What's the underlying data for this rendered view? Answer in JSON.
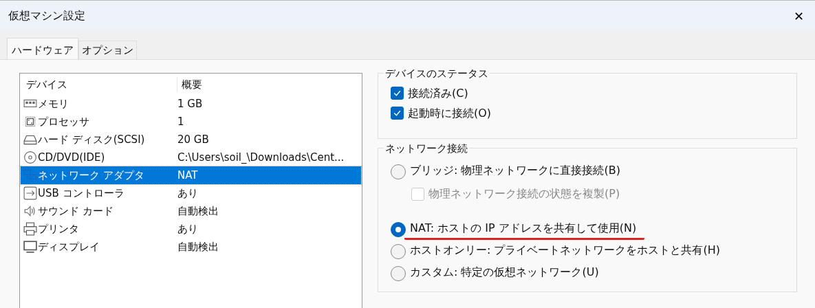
{
  "window": {
    "title": "仮想マシン設定",
    "close": "✕"
  },
  "tabs": [
    {
      "label": "ハードウェア",
      "selected": true
    },
    {
      "label": "オプション",
      "selected": false
    }
  ],
  "devices": {
    "columns": [
      "デバイス",
      "概要"
    ],
    "rows": [
      {
        "kind": "memory",
        "name": "メモリ",
        "summary": "1 GB",
        "selected": false
      },
      {
        "kind": "processor",
        "name": "プロセッサ",
        "summary": "1",
        "selected": false
      },
      {
        "kind": "disk",
        "name": "ハード ディスク(SCSI)",
        "summary": "20 GB",
        "selected": false
      },
      {
        "kind": "cd",
        "name": "CD/DVD(IDE)",
        "summary": "C:\\Users\\soil_\\Downloads\\Cent...",
        "selected": false
      },
      {
        "kind": "network",
        "name": "ネットワーク アダプタ",
        "summary": "NAT",
        "selected": true
      },
      {
        "kind": "usb",
        "name": "USB コントローラ",
        "summary": "あり",
        "selected": false
      },
      {
        "kind": "sound",
        "name": "サウンド カード",
        "summary": "自動検出",
        "selected": false
      },
      {
        "kind": "printer",
        "name": "プリンタ",
        "summary": "あり",
        "selected": false
      },
      {
        "kind": "display",
        "name": "ディスプレイ",
        "summary": "自動検出",
        "selected": false
      }
    ]
  },
  "device_status": {
    "title": "デバイスのステータス",
    "options": [
      {
        "label": "接続済み(C)",
        "checked": true
      },
      {
        "label": "起動時に接続(O)",
        "checked": true
      }
    ]
  },
  "network_connection": {
    "title": "ネットワーク接続",
    "options": [
      {
        "kind": "radio",
        "label": "ブリッジ: 物理ネットワークに直接接続(B)",
        "selected": false,
        "underlined": false
      },
      {
        "kind": "checkbox",
        "label": "物理ネットワーク接続の状態を複製(P)",
        "checked": false,
        "disabled": true
      },
      {
        "kind": "radio",
        "label": "NAT: ホストの IP アドレスを共有して使用(N)",
        "selected": true,
        "underlined": true
      },
      {
        "kind": "radio",
        "label": "ホストオンリー: プライベートネットワークをホストと共有(H)",
        "selected": false,
        "underlined": false
      },
      {
        "kind": "radio",
        "label": "カスタム: 特定の仮想ネットワーク(U)",
        "selected": false,
        "underlined": false
      }
    ]
  }
}
